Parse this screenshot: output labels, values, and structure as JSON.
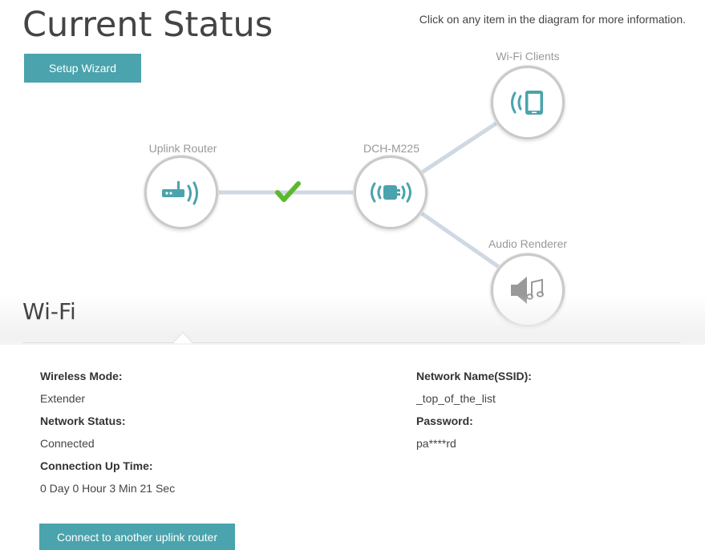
{
  "header": {
    "title": "Current Status",
    "hint": "Click on any item in the diagram for more information.",
    "setup_wizard_label": "Setup Wizard"
  },
  "diagram": {
    "nodes": [
      {
        "label": "Uplink Router",
        "icon": "router-icon"
      },
      {
        "label": "DCH-M225",
        "icon": "extender-icon"
      },
      {
        "label": "Wi-Fi Clients",
        "icon": "tablet-wifi-icon"
      },
      {
        "label": "Audio Renderer",
        "icon": "speaker-music-icon"
      }
    ],
    "link_status_icon": "checkmark-icon",
    "colors": {
      "accent": "#4aa3ad",
      "check": "#5cb82e",
      "link": "#cfd8e3"
    }
  },
  "wifi": {
    "title": "Wi-Fi",
    "left": [
      {
        "label": "Wireless Mode:",
        "value": "Extender"
      },
      {
        "label": "Network Status:",
        "value": "Connected"
      },
      {
        "label": "Connection Up Time:",
        "value": "0 Day 0 Hour 3 Min 21 Sec"
      }
    ],
    "right": [
      {
        "label": "Network Name(SSID):",
        "value": "_top_of_the_list"
      },
      {
        "label": "Password:",
        "value": "pa****rd"
      }
    ],
    "connect_button_label": "Connect to another uplink router"
  }
}
